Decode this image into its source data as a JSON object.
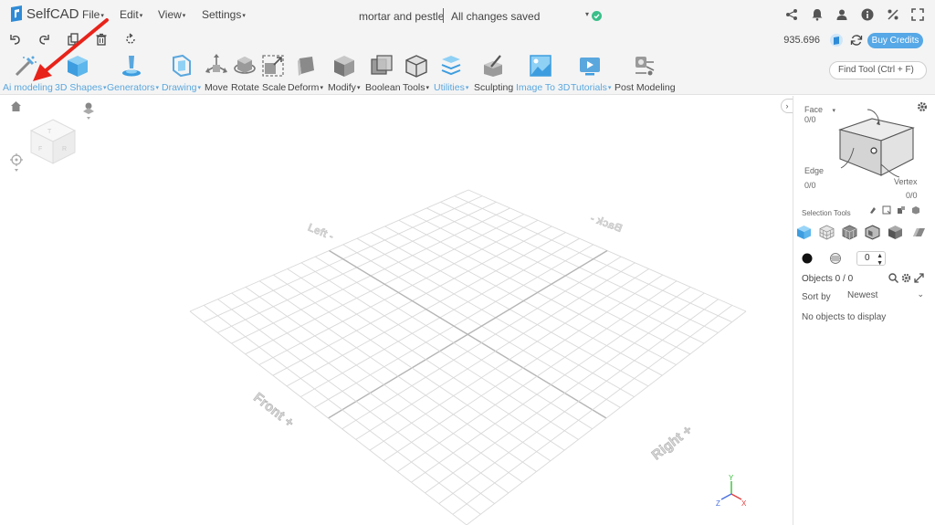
{
  "app": {
    "logo_text": "SelfCAD"
  },
  "menus": {
    "file": "File",
    "edit": "Edit",
    "view": "View",
    "settings": "Settings"
  },
  "document": {
    "title": "mortar and pestle",
    "save_status": "All changes saved"
  },
  "credits": {
    "balance": "935.696",
    "buy_label": "Buy Credits"
  },
  "tools": [
    {
      "label": "Ai modeling",
      "style": "blue"
    },
    {
      "label": "3D Shapes",
      "style": "blue",
      "dropdown": true
    },
    {
      "label": "Generators",
      "style": "blue",
      "dropdown": true
    },
    {
      "label": "Drawing",
      "style": "blue",
      "dropdown": true
    },
    {
      "label": "Move",
      "style": "dark"
    },
    {
      "label": "Rotate",
      "style": "dark"
    },
    {
      "label": "Scale",
      "style": "dark"
    },
    {
      "label": "Deform",
      "style": "dark",
      "dropdown": true
    },
    {
      "label": "Modify",
      "style": "dark",
      "dropdown": true
    },
    {
      "label": "Boolean",
      "style": "dark"
    },
    {
      "label": "Tools",
      "style": "dark",
      "dropdown": true
    },
    {
      "label": "Utilities",
      "style": "blue",
      "dropdown": true
    },
    {
      "label": "Sculpting",
      "style": "dark"
    },
    {
      "label": "Image To 3D",
      "style": "blue"
    },
    {
      "label": "Tutorials",
      "style": "blue",
      "dropdown": true
    },
    {
      "label": "Post Modeling",
      "style": "dark"
    }
  ],
  "search": {
    "placeholder": "Find Tool (Ctrl + F)"
  },
  "viewport": {
    "grid_labels": {
      "left": "Left -",
      "back": "Back -",
      "front": "Front +",
      "right": "Right +"
    },
    "axes": {
      "x": "X",
      "y": "Y",
      "z": "Z"
    }
  },
  "panel": {
    "face_label": "Face",
    "face_count": "0/0",
    "edge_label": "Edge",
    "edge_count": "0/0",
    "vertex_label": "Vertex",
    "vertex_count": "0/0",
    "selection_tools_label": "Selection Tools",
    "stepper_value": "0",
    "objects_label": "Objects 0 / 0",
    "sort_by_label": "Sort by",
    "sort_value": "Newest",
    "empty_message": "No objects to display"
  },
  "colors": {
    "accent": "#56a8e6",
    "annotation_arrow": "#e8231a",
    "tool_blue": "#5aa7de"
  },
  "annotation": {
    "arrow": "red arrow pointing to Ai modeling tool"
  }
}
